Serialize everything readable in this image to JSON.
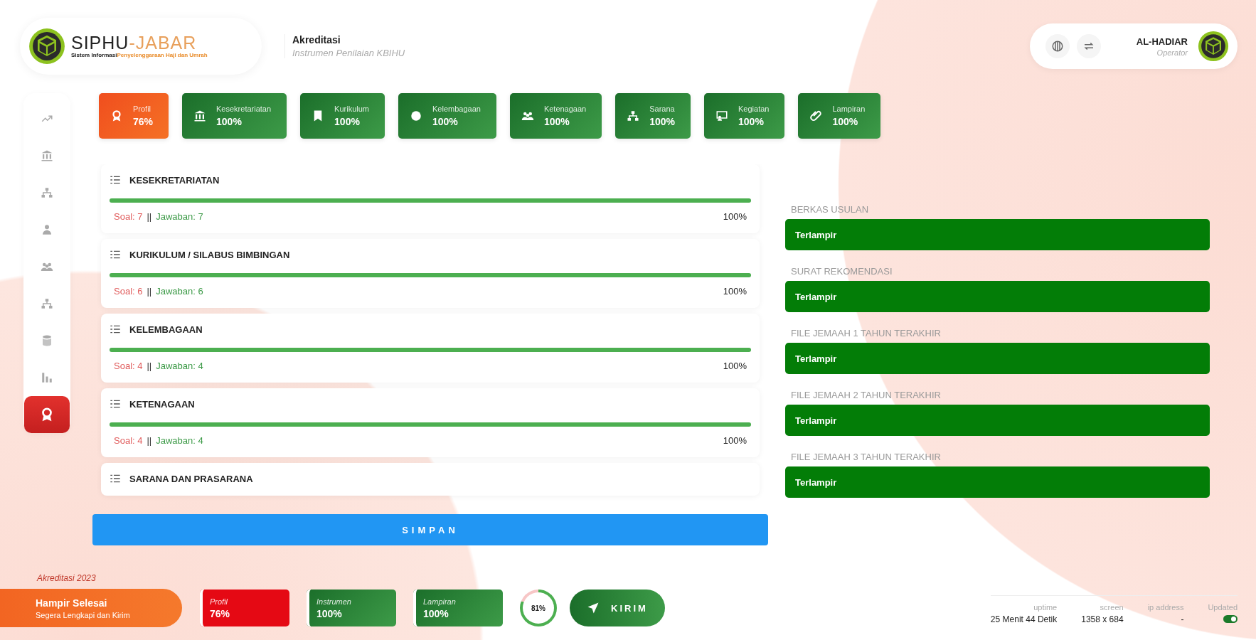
{
  "header": {
    "logo": {
      "name_dark": "SIPHU",
      "name_accent": "-JABAR",
      "tagline_dark": "Sistem Informasi",
      "tagline_accent": "Penyelenggaraan Haji dan Umrah"
    },
    "page": {
      "title": "Akreditasi",
      "subtitle": "Instrumen Penilaian KBIHU"
    },
    "user": {
      "name": "AL-HADIAR",
      "role": "Operator"
    }
  },
  "sidebar": {
    "items": [
      {
        "selected": false
      },
      {
        "selected": false
      },
      {
        "selected": false
      },
      {
        "selected": false
      },
      {
        "selected": false
      },
      {
        "selected": false
      },
      {
        "selected": false
      },
      {
        "selected": false
      },
      {
        "selected": true
      }
    ]
  },
  "tabs": [
    {
      "label": "Profil",
      "value": "76%",
      "complete": false
    },
    {
      "label": "Kesekretariatan",
      "value": "100%",
      "complete": true
    },
    {
      "label": "Kurikulum",
      "value": "100%",
      "complete": true
    },
    {
      "label": "Kelembagaan",
      "value": "100%",
      "complete": true
    },
    {
      "label": "Ketenagaan",
      "value": "100%",
      "complete": true
    },
    {
      "label": "Sarana",
      "value": "100%",
      "complete": true
    },
    {
      "label": "Kegiatan",
      "value": "100%",
      "complete": true
    },
    {
      "label": "Lampiran",
      "value": "100%",
      "complete": true
    }
  ],
  "sections": [
    {
      "title": "KESEKRETARIATAN",
      "soal": "Soal: 7",
      "separator": "||",
      "jawaban": "Jawaban: 7",
      "percent": "100%",
      "level": 1
    },
    {
      "title": "KURIKULUM / SILABUS BIMBINGAN",
      "soal": "Soal: 6",
      "separator": "||",
      "jawaban": "Jawaban: 6",
      "percent": "100%",
      "level": 1
    },
    {
      "title": "KELEMBAGAAN",
      "soal": "Soal: 4",
      "separator": "||",
      "jawaban": "Jawaban: 4",
      "percent": "100%",
      "level": 1
    },
    {
      "title": "KETENAGAAN",
      "soal": "Soal: 4",
      "separator": "||",
      "jawaban": "Jawaban: 4",
      "percent": "100%",
      "level": 1
    },
    {
      "title": "SARANA DAN PRASARANA"
    }
  ],
  "save_button": "SIMPAN",
  "attachments": [
    {
      "label": "BERKAS USULAN",
      "status": "Terlampir"
    },
    {
      "label": "SURAT REKOMENDASI",
      "status": "Terlampir"
    },
    {
      "label": "FILE JEMAAH 1 TAHUN TERAKHIR",
      "status": "Terlampir"
    },
    {
      "label": "FILE JEMAAH 2 TAHUN TERAKHIR",
      "status": "Terlampir"
    },
    {
      "label": "FILE JEMAAH 3 TAHUN TERAKHIR",
      "status": "Terlampir"
    }
  ],
  "footer": {
    "year_label": "Akreditasi 2023",
    "status": {
      "title": "Hampir Selesai",
      "subtitle": "Segera Lengkapi dan Kirim"
    },
    "summary": [
      {
        "label": "Profil",
        "value": "76%",
        "complete": false
      },
      {
        "label": "Instrumen",
        "value": "100%",
        "complete": true
      },
      {
        "label": "Lampiran",
        "value": "100%",
        "complete": true
      }
    ],
    "progress": {
      "label": "81%",
      "level": 0.81
    },
    "send_button": "KIRIM"
  },
  "status_bar": [
    {
      "label": "uptime",
      "value": "25 Menit 44 Detik",
      "kind": "text"
    },
    {
      "label": "screen",
      "value": "1358 x 684",
      "kind": "text"
    },
    {
      "label": "ip address",
      "value": "-",
      "kind": "text"
    },
    {
      "label": "Updated",
      "kind": "toggle",
      "on": true
    }
  ]
}
